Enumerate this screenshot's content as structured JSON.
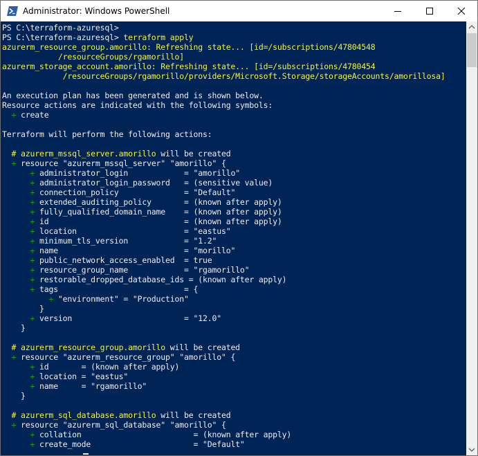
{
  "window": {
    "title": "Administrator: Windows PowerShell",
    "icon": "powershell-icon",
    "controls": [
      "minimize-icon",
      "maximize-icon",
      "close-icon"
    ]
  },
  "colors": {
    "console_bg": "#012456",
    "text": "#eeedf0",
    "warning_yellow": "#f6f233",
    "plus_green": "#13a10e"
  },
  "console": {
    "lines": [
      [
        {
          "t": "PS C:\\terraform-azuresql>",
          "c": "white"
        }
      ],
      [
        {
          "t": "PS C:\\terraform-azuresql> ",
          "c": "white"
        },
        {
          "t": "terraform apply",
          "c": "yellow"
        }
      ],
      [
        {
          "t": "azurerm_resource_group.amorillo: Refreshing state... [id=/subscriptions/47804548",
          "c": "yellow"
        }
      ],
      [
        {
          "t": "            /resourceGroups/rgamorillo]",
          "c": "yellow"
        }
      ],
      [
        {
          "t": "azurerm_storage_account.amorillo: Refreshing state... [id=/subscriptions/4780454",
          "c": "yellow"
        }
      ],
      [
        {
          "t": "             /resourceGroups/rgamorillo/providers/Microsoft.Storage/storageAccounts/amorillosa]",
          "c": "yellow"
        }
      ],
      [],
      [
        {
          "t": "An execution plan has been generated and is shown below.",
          "c": "white"
        }
      ],
      [
        {
          "t": "Resource actions are indicated with the following symbols:",
          "c": "white"
        }
      ],
      [
        {
          "t": "  ",
          "c": "white"
        },
        {
          "t": "+",
          "c": "green"
        },
        {
          "t": " create",
          "c": "white"
        }
      ],
      [],
      [
        {
          "t": "Terraform will perform the following actions:",
          "c": "white"
        }
      ],
      [],
      [
        {
          "t": "  # azurerm_mssql_server.amorillo",
          "c": "yellow"
        },
        {
          "t": " will be created",
          "c": "white"
        }
      ],
      [
        {
          "t": "  ",
          "c": "white"
        },
        {
          "t": "+",
          "c": "green"
        },
        {
          "t": " resource \"azurerm_mssql_server\" \"amorillo\" {",
          "c": "white"
        }
      ],
      [
        {
          "t": "      ",
          "c": "white"
        },
        {
          "t": "+",
          "c": "green"
        },
        {
          "t": " administrator_login            = \"amorillo\"",
          "c": "white"
        }
      ],
      [
        {
          "t": "      ",
          "c": "white"
        },
        {
          "t": "+",
          "c": "green"
        },
        {
          "t": " administrator_login_password   = (sensitive value)",
          "c": "white"
        }
      ],
      [
        {
          "t": "      ",
          "c": "white"
        },
        {
          "t": "+",
          "c": "green"
        },
        {
          "t": " connection_policy              = \"Default\"",
          "c": "white"
        }
      ],
      [
        {
          "t": "      ",
          "c": "white"
        },
        {
          "t": "+",
          "c": "green"
        },
        {
          "t": " extended_auditing_policy       = (known after apply)",
          "c": "white"
        }
      ],
      [
        {
          "t": "      ",
          "c": "white"
        },
        {
          "t": "+",
          "c": "green"
        },
        {
          "t": " fully_qualified_domain_name    = (known after apply)",
          "c": "white"
        }
      ],
      [
        {
          "t": "      ",
          "c": "white"
        },
        {
          "t": "+",
          "c": "green"
        },
        {
          "t": " id                             = (known after apply)",
          "c": "white"
        }
      ],
      [
        {
          "t": "      ",
          "c": "white"
        },
        {
          "t": "+",
          "c": "green"
        },
        {
          "t": " location                       = \"eastus\"",
          "c": "white"
        }
      ],
      [
        {
          "t": "      ",
          "c": "white"
        },
        {
          "t": "+",
          "c": "green"
        },
        {
          "t": " minimum_tls_version            = \"1.2\"",
          "c": "white"
        }
      ],
      [
        {
          "t": "      ",
          "c": "white"
        },
        {
          "t": "+",
          "c": "green"
        },
        {
          "t": " name                           = \"morillo\"",
          "c": "white"
        }
      ],
      [
        {
          "t": "      ",
          "c": "white"
        },
        {
          "t": "+",
          "c": "green"
        },
        {
          "t": " public_network_access_enabled  = true",
          "c": "white"
        }
      ],
      [
        {
          "t": "      ",
          "c": "white"
        },
        {
          "t": "+",
          "c": "green"
        },
        {
          "t": " resource_group_name            = \"rgamorillo\"",
          "c": "white"
        }
      ],
      [
        {
          "t": "      ",
          "c": "white"
        },
        {
          "t": "+",
          "c": "green"
        },
        {
          "t": " restorable_dropped_database_ids = (known after apply)",
          "c": "white"
        }
      ],
      [
        {
          "t": "      ",
          "c": "white"
        },
        {
          "t": "+",
          "c": "green"
        },
        {
          "t": " tags                           = {",
          "c": "white"
        }
      ],
      [
        {
          "t": "          ",
          "c": "white"
        },
        {
          "t": "+",
          "c": "green"
        },
        {
          "t": " \"environment\" = \"Production\"",
          "c": "white"
        }
      ],
      [
        {
          "t": "        }",
          "c": "white"
        }
      ],
      [
        {
          "t": "      ",
          "c": "white"
        },
        {
          "t": "+",
          "c": "green"
        },
        {
          "t": " version                        = \"12.0\"",
          "c": "white"
        }
      ],
      [
        {
          "t": "    }",
          "c": "white"
        }
      ],
      [],
      [
        {
          "t": "  # azurerm_resource_group.amorillo",
          "c": "yellow"
        },
        {
          "t": " will be created",
          "c": "white"
        }
      ],
      [
        {
          "t": "  ",
          "c": "white"
        },
        {
          "t": "+",
          "c": "green"
        },
        {
          "t": " resource \"azurerm_resource_group\" \"amorillo\" {",
          "c": "white"
        }
      ],
      [
        {
          "t": "      ",
          "c": "white"
        },
        {
          "t": "+",
          "c": "green"
        },
        {
          "t": " id       = (known after apply)",
          "c": "white"
        }
      ],
      [
        {
          "t": "      ",
          "c": "white"
        },
        {
          "t": "+",
          "c": "green"
        },
        {
          "t": " location = \"eastus\"",
          "c": "white"
        }
      ],
      [
        {
          "t": "      ",
          "c": "white"
        },
        {
          "t": "+",
          "c": "green"
        },
        {
          "t": " name     = \"rgamorillo\"",
          "c": "white"
        }
      ],
      [
        {
          "t": "    }",
          "c": "white"
        }
      ],
      [],
      [
        {
          "t": "  # azurerm_sql_database.amorillo",
          "c": "yellow"
        },
        {
          "t": " will be created",
          "c": "white"
        }
      ],
      [
        {
          "t": "  ",
          "c": "white"
        },
        {
          "t": "+",
          "c": "green"
        },
        {
          "t": " resource \"azurerm_sql_database\" \"amorillo\" {",
          "c": "white"
        }
      ],
      [
        {
          "t": "      ",
          "c": "white"
        },
        {
          "t": "+",
          "c": "green"
        },
        {
          "t": " collation                        = (known after apply)",
          "c": "white"
        }
      ],
      [
        {
          "t": "      ",
          "c": "white"
        },
        {
          "t": "+",
          "c": "green"
        },
        {
          "t": " create_mode                      = \"Default\"",
          "c": "white"
        }
      ]
    ]
  },
  "scrollbar": {
    "up_icon": "scroll-up-arrow-icon",
    "down_icon": "scroll-down-arrow-icon"
  }
}
